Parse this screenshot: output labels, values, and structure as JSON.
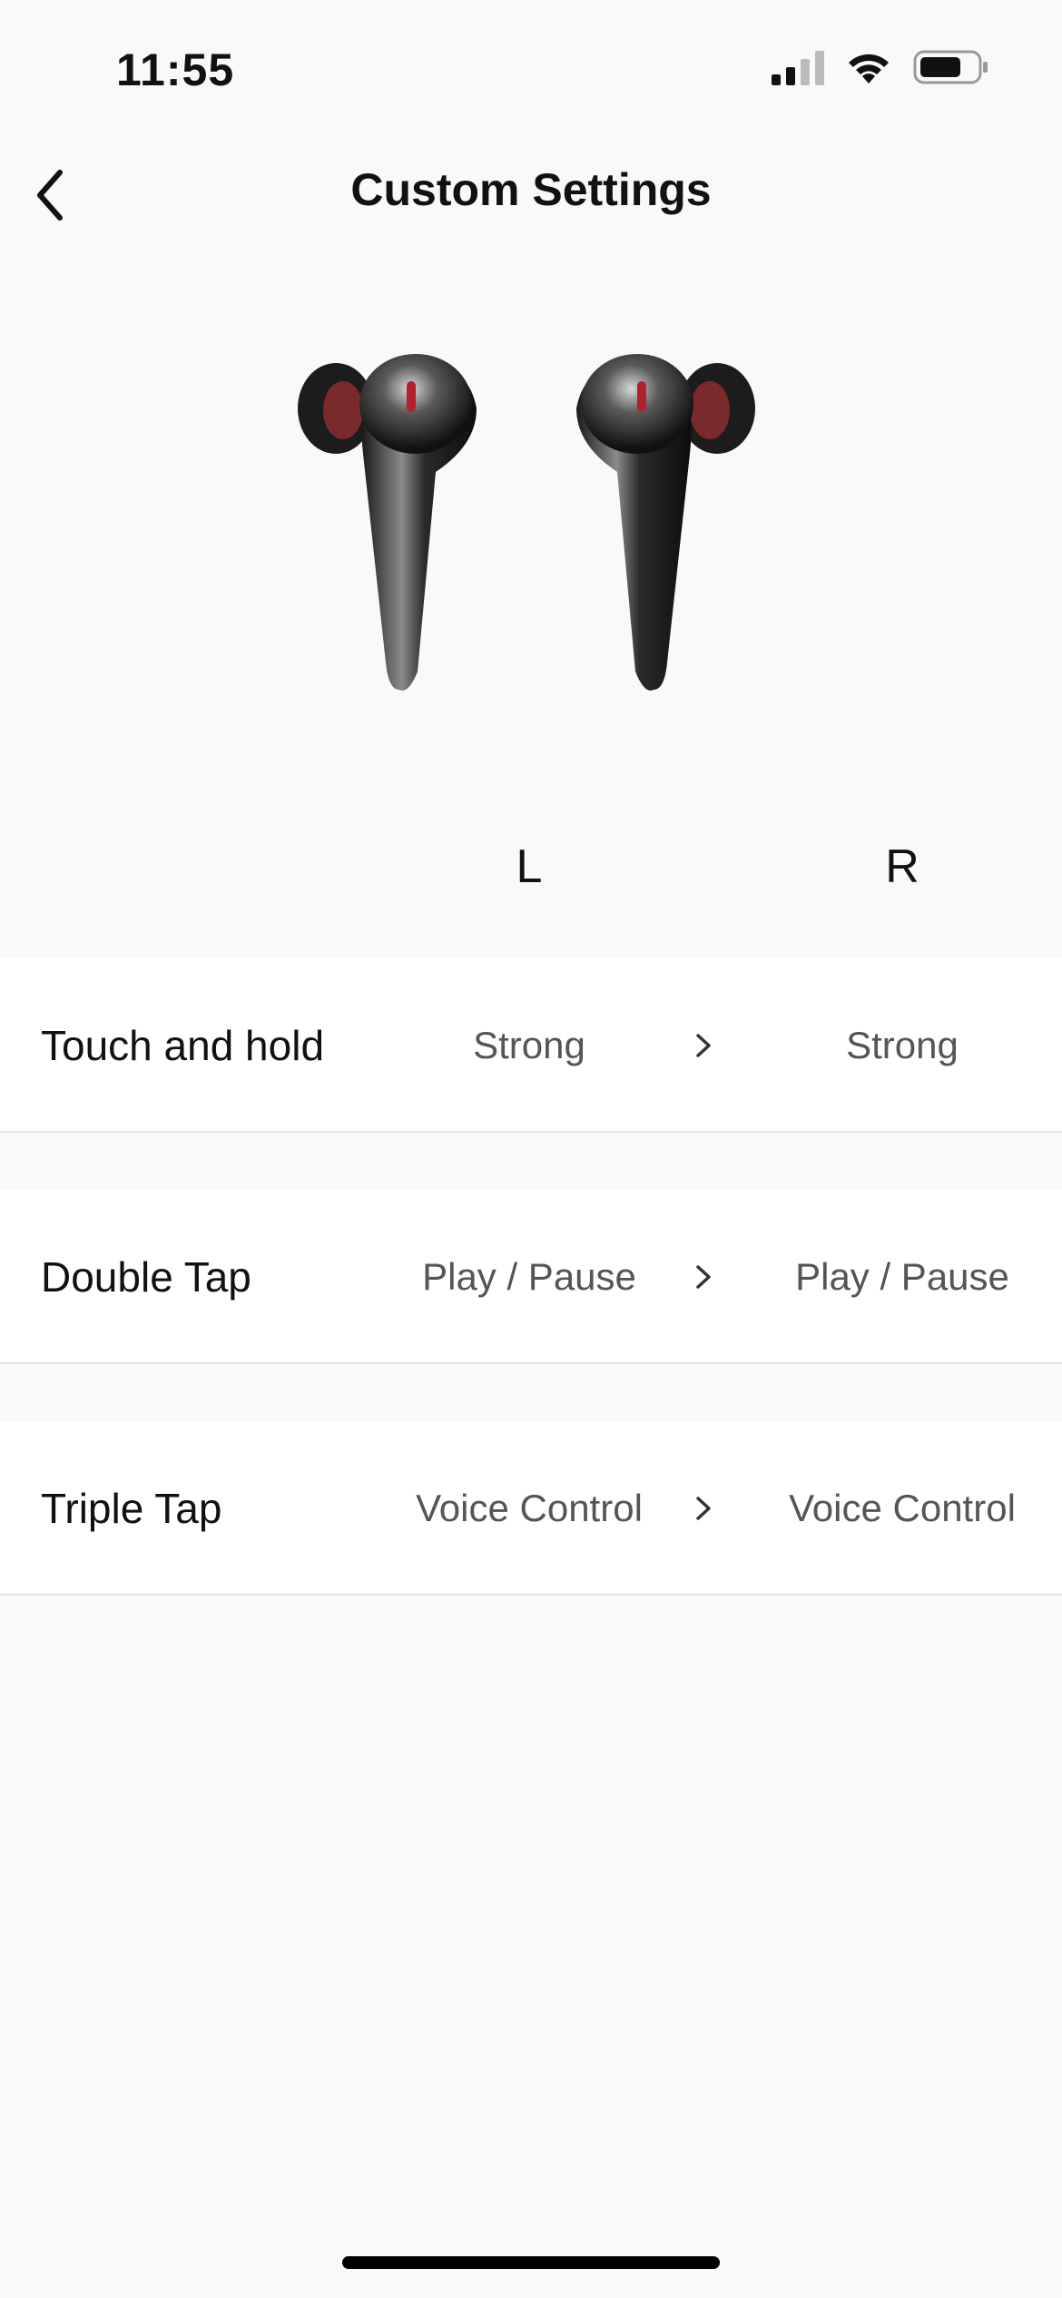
{
  "status_bar": {
    "time": "11:55"
  },
  "header": {
    "title": "Custom Settings",
    "back_icon": "chevron-left-icon"
  },
  "columns": {
    "left": "L",
    "right": "R"
  },
  "settings": [
    {
      "label": "Touch and hold",
      "left_value": "Strong",
      "right_value": "Strong"
    },
    {
      "label": "Double Tap",
      "left_value": "Play / Pause",
      "right_value": "Play / Pause"
    },
    {
      "label": "Triple Tap",
      "left_value": "Voice Control",
      "right_value": "Voice Control"
    }
  ],
  "colors": {
    "background": "#f9f9f9",
    "row_background": "#ffffff",
    "earbud_accent": "#b3202a"
  }
}
